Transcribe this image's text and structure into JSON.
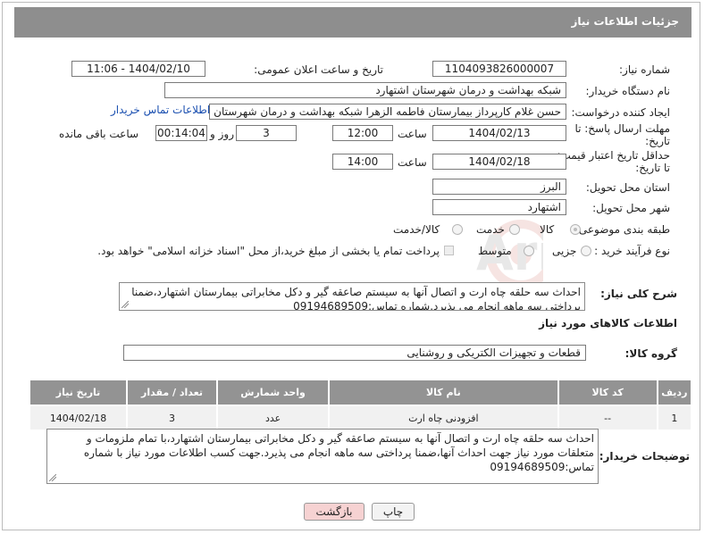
{
  "header": {
    "title": "جزئیات اطلاعات نیاز"
  },
  "form": {
    "need_number_label": "شماره نیاز:",
    "need_number": "1104093826000007",
    "announce_label": "تاریخ و ساعت اعلان عمومی:",
    "announce_value": "1404/02/10 - 11:06",
    "buyer_org_label": "نام دستگاه خریدار:",
    "buyer_org": "شبکه بهداشت و درمان شهرستان اشتهارد",
    "creator_label": "ایجاد کننده درخواست:",
    "creator": "حسن غلام کارپرداز بیمارستان فاطمه الزهرا شبکه بهداشت و درمان شهرستان ا",
    "contact_link": "اطلاعات تماس خریدار",
    "deadline_label_1": "مهلت ارسال پاسخ: تا",
    "deadline_label_2": "تاریخ:",
    "deadline_date": "1404/02/13",
    "time_label": "ساعت",
    "deadline_time": "12:00",
    "days_value": "3",
    "days_label": "روز و",
    "remaining_time": "00:14:04",
    "remaining_label": "ساعت باقی مانده",
    "price_label_1": "حداقل تاریخ اعتبار قیمت:",
    "price_label_2": "تا تاریخ:",
    "price_date": "1404/02/18",
    "price_time": "14:00",
    "province_label": "استان محل تحویل:",
    "province": "البرز",
    "city_label": "شهر محل تحویل:",
    "city": "اشتهارد",
    "category_label": "طبقه بندی موضوعی:",
    "category_options": [
      "کالا",
      "خدمت",
      "کالا/خدمت"
    ],
    "process_label": "نوع فرآیند خرید :",
    "process_options": [
      "جزیی",
      "متوسط"
    ],
    "payment_note": "پرداخت تمام یا بخشی از مبلغ خرید،از محل \"اسناد خزانه اسلامی\" خواهد بود."
  },
  "description": {
    "label": "شرح کلی نیاز:",
    "text": "احداث سه حلقه چاه ارت و اتصال آنها به سیستم صاعقه گیر و دکل مخابراتی بیمارستان اشتهارد،ضمنا پرداختی سه ماهه انجام می پذیرد.شماره تماس:09194689509"
  },
  "goods_section": {
    "title": "اطلاعات کالاهای مورد نیاز",
    "group_label": "گروه کالا:",
    "group_value": "قطعات و تجهیزات الکتریکی و روشنایی"
  },
  "table": {
    "headers": [
      "ردیف",
      "کد کالا",
      "نام کالا",
      "واحد شمارش",
      "تعداد / مقدار",
      "تاریخ نیاز"
    ],
    "rows": [
      {
        "row": "1",
        "code": "--",
        "name": "افزودنی چاه ارت",
        "unit": "عدد",
        "qty": "3",
        "date": "1404/02/18"
      }
    ]
  },
  "buyer_notes": {
    "label": "توضیحات خریدار:",
    "text": "احداث سه حلقه چاه ارت و اتصال آنها به سیستم صاعقه گیر و دکل مخابراتی بیمارستان اشتهارد،با تمام ملزومات و متعلقات مورد نیاز جهت احداث آنها،ضمنا پرداختی سه ماهه انجام می پذیرد.جهت کسب اطلاعات مورد نیاز با شماره تماس:09194689509"
  },
  "buttons": {
    "print": "چاپ",
    "back": "بازگشت"
  },
  "colors": {
    "header_bg": "#8e8e8e",
    "table_header_bg": "#939393",
    "link": "#1a4fb0",
    "back_button_bg": "#f6d2d2"
  },
  "icons": [
    "radio-icon",
    "checkbox-icon",
    "resize-grip-icon",
    "watermark-logo"
  ]
}
